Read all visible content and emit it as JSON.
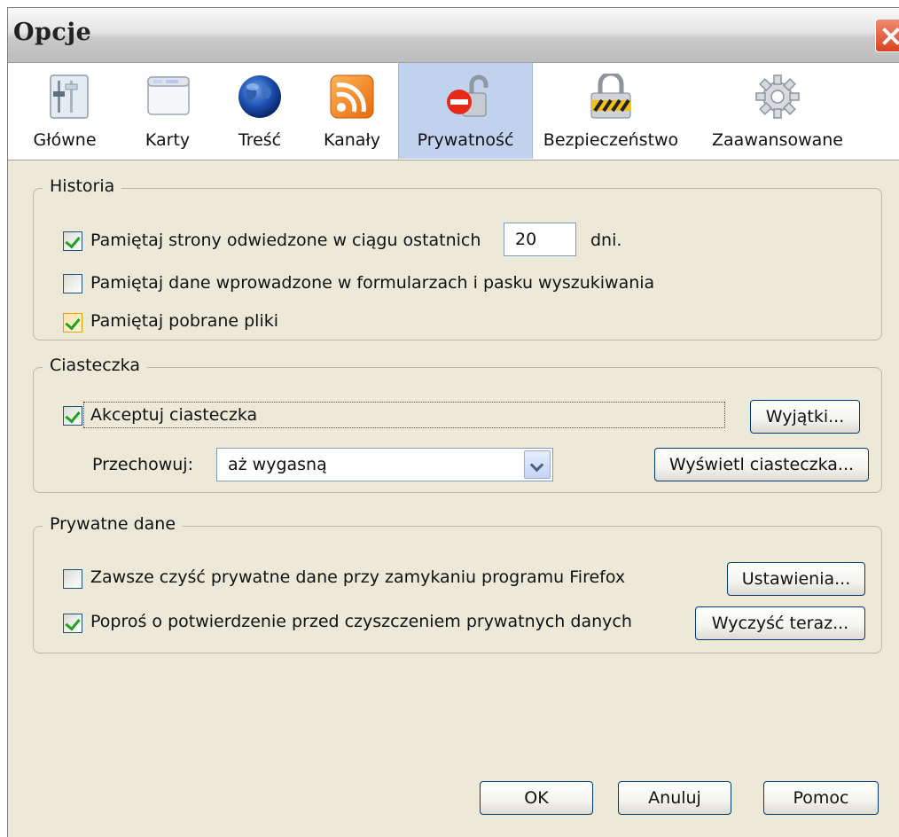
{
  "window": {
    "title": "Opcje"
  },
  "toolbar": {
    "items": [
      {
        "label": "Główne",
        "icon": "general-sliders-icon",
        "selected": false
      },
      {
        "label": "Karty",
        "icon": "tabs-window-icon",
        "selected": false
      },
      {
        "label": "Treść",
        "icon": "content-globe-icon",
        "selected": false
      },
      {
        "label": "Kanały",
        "icon": "feeds-rss-icon",
        "selected": false
      },
      {
        "label": "Prywatność",
        "icon": "privacy-padlock-icon",
        "selected": true
      },
      {
        "label": "Bezpieczeństwo",
        "icon": "security-padlock-icon",
        "selected": false
      },
      {
        "label": "Zaawansowane",
        "icon": "advanced-gear-icon",
        "selected": false
      }
    ]
  },
  "history": {
    "title": "Historia",
    "remember_pages_label": "Pamiętaj strony odwiedzone w ciągu ostatnich",
    "remember_pages_checked": true,
    "days_value": "20",
    "days_unit": "dni.",
    "remember_forms_label": "Pamiętaj dane wprowadzone w formularzach i pasku wyszukiwania",
    "remember_forms_checked": false,
    "remember_downloads_label": "Pamiętaj pobrane pliki",
    "remember_downloads_checked": true
  },
  "cookies": {
    "title": "Ciasteczka",
    "accept_label": "Akceptuj ciasteczka",
    "accept_checked": true,
    "exceptions_button": "Wyjątki...",
    "keep_label": "Przechowuj:",
    "keep_value": "aż wygasną",
    "show_cookies_button": "Wyświetl ciasteczka..."
  },
  "private_data": {
    "title": "Prywatne dane",
    "always_clear_label": "Zawsze czyść prywatne dane przy zamykaniu programu Firefox",
    "always_clear_checked": false,
    "settings_button": "Ustawienia...",
    "ask_before_label": "Poproś o potwierdzenie przed czyszczeniem prywatnych danych",
    "ask_before_checked": true,
    "clear_now_button": "Wyczyść teraz..."
  },
  "footer": {
    "ok": "OK",
    "cancel": "Anuluj",
    "help": "Pomoc"
  },
  "colors": {
    "accent": "#c1d2ee",
    "checkmark": "#21a121",
    "dialog_bg": "#ece9d8"
  }
}
